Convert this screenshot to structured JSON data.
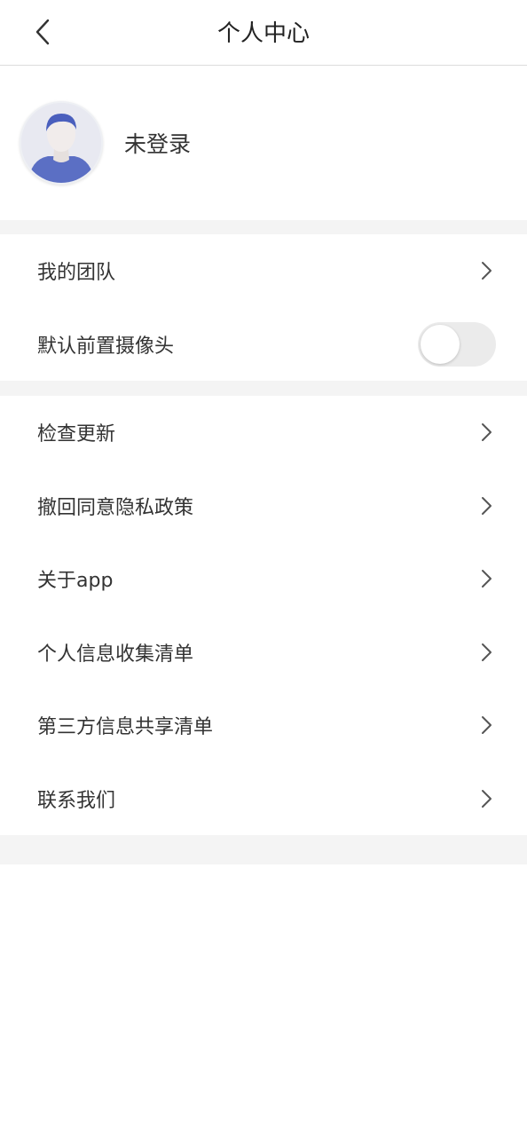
{
  "header": {
    "title": "个人中心",
    "back_icon": "chevron-left-icon"
  },
  "profile": {
    "login_status": "未登录",
    "avatar_icon": "default-user-avatar",
    "avatar_color": "#5b6fc4"
  },
  "group1": {
    "my_team": "我的团队",
    "front_camera": {
      "label": "默认前置摄像头",
      "enabled": false
    }
  },
  "menu": [
    "检查更新",
    "撤回同意隐私政策",
    "关于app",
    "个人信息收集清单",
    "第三方信息共享清单",
    "联系我们"
  ]
}
